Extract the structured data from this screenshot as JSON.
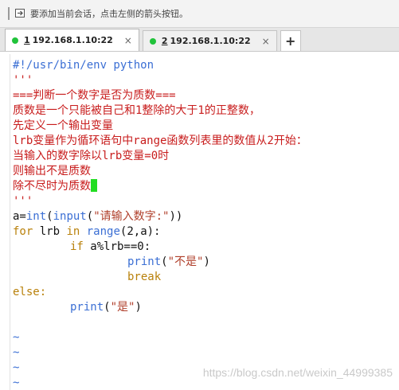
{
  "hint_bar": {
    "text": "要添加当前会话，点击左侧的箭头按钮。",
    "icon": "add-session-arrow-icon"
  },
  "tabs": [
    {
      "number": "1",
      "label": "192.168.1.10:22",
      "active": true,
      "status_color": "#21c33b",
      "close": "×"
    },
    {
      "number": "2",
      "label": "192.168.1.10:22",
      "active": false,
      "status_color": "#21c33b",
      "close": "×"
    }
  ],
  "tab_add_label": "+",
  "editor": {
    "lines": [
      {
        "segments": [
          {
            "text": "#!/usr/bin/env python",
            "color": "blue"
          }
        ]
      },
      {
        "segments": [
          {
            "text": "'''",
            "color": "red"
          }
        ]
      },
      {
        "segments": [
          {
            "text": "===判断一个数字是否为质数===",
            "color": "red"
          }
        ]
      },
      {
        "segments": [
          {
            "text": "质数是一个只能被自己和1整除的大于1的正整数，",
            "color": "red"
          }
        ]
      },
      {
        "segments": [
          {
            "text": "先定义一个输出变量",
            "color": "red"
          }
        ]
      },
      {
        "segments": [
          {
            "text": "lrb变量作为循环语句中range函数列表里的数值从2开始：",
            "color": "red"
          }
        ]
      },
      {
        "segments": [
          {
            "text": "当输入的数字除以lrb变量=0时",
            "color": "red"
          }
        ]
      },
      {
        "segments": [
          {
            "text": "则输出不是质数",
            "color": "red"
          }
        ]
      },
      {
        "segments": [
          {
            "text": "除不尽时为质数",
            "color": "red"
          }
        ],
        "cursor": true
      },
      {
        "segments": [
          {
            "text": "'''",
            "color": "red"
          }
        ]
      },
      {
        "segments": [
          {
            "text": "a=",
            "color": "black"
          },
          {
            "text": "int",
            "color": "blue"
          },
          {
            "text": "(",
            "color": "black"
          },
          {
            "text": "input",
            "color": "blue"
          },
          {
            "text": "(",
            "color": "black"
          },
          {
            "text": "\"请输入数字:\"",
            "color": "string"
          },
          {
            "text": "))",
            "color": "black"
          }
        ]
      },
      {
        "segments": [
          {
            "text": "for",
            "color": "orange"
          },
          {
            "text": " lrb ",
            "color": "black"
          },
          {
            "text": "in",
            "color": "orange"
          },
          {
            "text": " ",
            "color": "black"
          },
          {
            "text": "range",
            "color": "blue"
          },
          {
            "text": "(2,a):",
            "color": "black"
          }
        ]
      },
      {
        "indent": 1,
        "segments": [
          {
            "text": "if",
            "color": "orange"
          },
          {
            "text": " a%lrb==0:",
            "color": "black"
          }
        ]
      },
      {
        "indent": 2,
        "segments": [
          {
            "text": "print",
            "color": "blue"
          },
          {
            "text": "(",
            "color": "black"
          },
          {
            "text": "\"不是\"",
            "color": "string"
          },
          {
            "text": ")",
            "color": "black"
          }
        ]
      },
      {
        "indent": 2,
        "segments": [
          {
            "text": "break",
            "color": "orange"
          }
        ]
      },
      {
        "segments": [
          {
            "text": "else:",
            "color": "orange"
          }
        ]
      },
      {
        "indent": 1,
        "segments": [
          {
            "text": "print",
            "color": "blue"
          },
          {
            "text": "(",
            "color": "black"
          },
          {
            "text": "\"是\"",
            "color": "string"
          },
          {
            "text": ")",
            "color": "black"
          }
        ]
      },
      {
        "segments": []
      },
      {
        "segments": [
          {
            "text": "~",
            "color": "tilde"
          }
        ]
      },
      {
        "segments": [
          {
            "text": "~",
            "color": "tilde"
          }
        ]
      },
      {
        "segments": [
          {
            "text": "~",
            "color": "tilde"
          }
        ]
      },
      {
        "segments": [
          {
            "text": "~",
            "color": "tilde"
          }
        ]
      }
    ]
  },
  "colors": {
    "keyword_blue": "#3b6fd4",
    "comment_red": "#c81c1c",
    "control_orange": "#b9810b",
    "string": "#b0402c",
    "cursor_green": "#22dd22"
  },
  "watermark": "https://blog.csdn.net/weixin_44999385"
}
